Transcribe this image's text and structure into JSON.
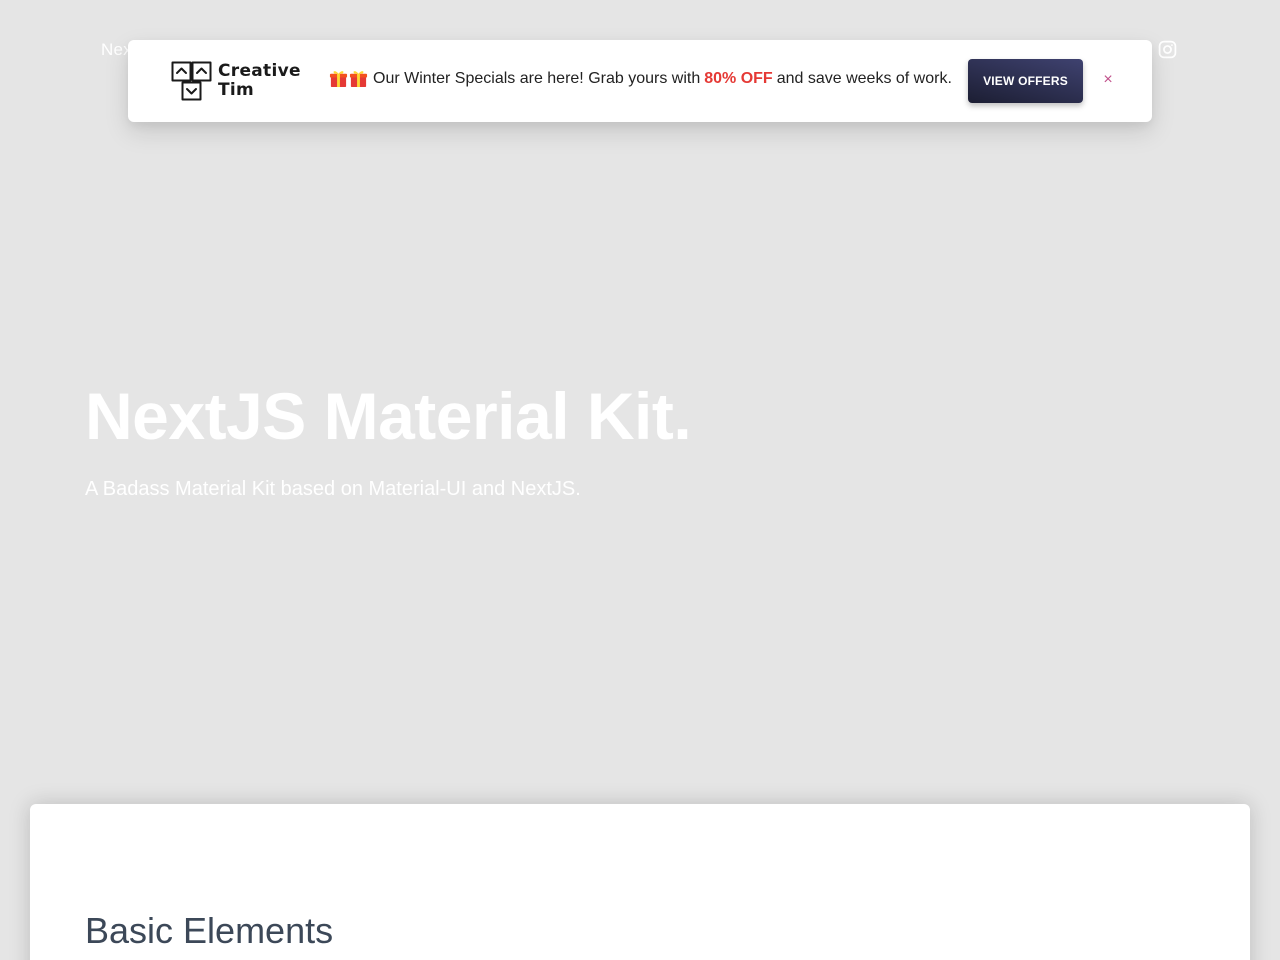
{
  "navbar": {
    "brand": "NextJS Material Kit",
    "instagram_icon": "instagram-icon"
  },
  "promo": {
    "logo": {
      "line1": "Creative",
      "line2": "Tim",
      "icon": "creative-tim-logo-icon"
    },
    "gift_icon": "gift-icon",
    "message_before": "Our Winter Specials are here! Grab yours with",
    "message_highlight": "80% OFF",
    "message_after": "and save weeks of work.",
    "cta_label": "VIEW OFFERS",
    "close_label": "×",
    "colors": {
      "highlight": "#e53935",
      "cta_start": "#3f4270",
      "cta_end": "#1c1e33",
      "close": "#c0508a"
    }
  },
  "hero": {
    "title": "NextJS Material Kit.",
    "subtitle": "A Badass Material Kit based on Material-UI and NextJS."
  },
  "main": {
    "section_title": "Basic Elements"
  },
  "colors": {
    "background": "#e5e5e5",
    "card": "#ffffff",
    "section_title": "#3c4858"
  }
}
